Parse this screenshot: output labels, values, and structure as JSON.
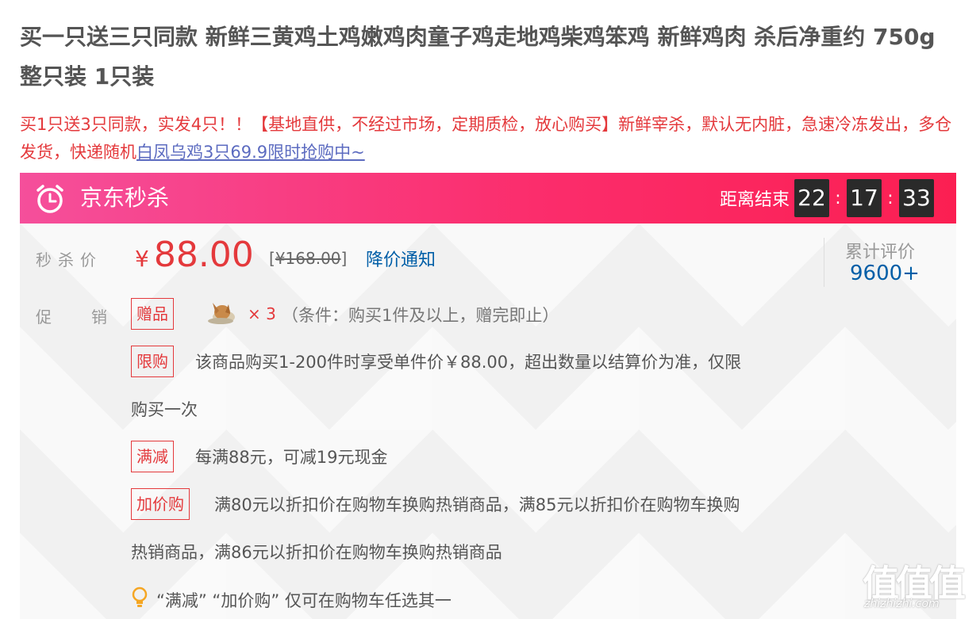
{
  "product": {
    "title": "买一只送三只同款 新鲜三黄鸡土鸡嫩鸡肉童子鸡走地鸡柴鸡笨鸡 新鲜鸡肉 杀后净重约 750g 整只装 1只装",
    "subtitle": "买1只送3只同款，实发4只！！【基地直供，不经过市场，定期质检，放心购买】新鲜宰杀，默认无内脏，急速冷冻发出，多仓发货，快递随机",
    "subtitle_link": "白凤乌鸡3只69.9限时抢购中~"
  },
  "seckill": {
    "title": "京东秒杀",
    "countdown_label": "距离结束",
    "hours": "22",
    "minutes": "17",
    "seconds": "33",
    "separator": ":",
    "bar_color": "#fb2d6c"
  },
  "price": {
    "label": "秒杀价",
    "currency": "¥",
    "current": "88.00",
    "original_open": "[",
    "original": "¥168.00",
    "original_close": "]",
    "notify_label": "降价通知",
    "color": "#e4393c"
  },
  "reviews": {
    "label": "累计评价",
    "count": "9600+"
  },
  "promotions": {
    "label": "促销",
    "gift": {
      "tag": "赠品",
      "icon": "chicken-gift-icon",
      "count": "× 3",
      "condition": "（条件：购买1件及以上，赠完即止）"
    },
    "limit": {
      "tag": "限购",
      "line1": "该商品购买1-200件时享受单件价￥88.00，超出数量以结算价为准，仅限",
      "line2": "购买一次"
    },
    "discount": {
      "tag": "满减",
      "text": "每满88元，可减19元现金"
    },
    "addon": {
      "tag": "加价购",
      "line1": "满80元以折扣价在购物车换购热销商品，满85元以折扣价在购物车换购",
      "line2": "热销商品，满86元以折扣价在购物车换购热销商品"
    },
    "tip": "“满减” “加价购” 仅可在购物车任选其一"
  },
  "watermark": {
    "logo": "值值值",
    "url": "zhizhizhi.com"
  }
}
